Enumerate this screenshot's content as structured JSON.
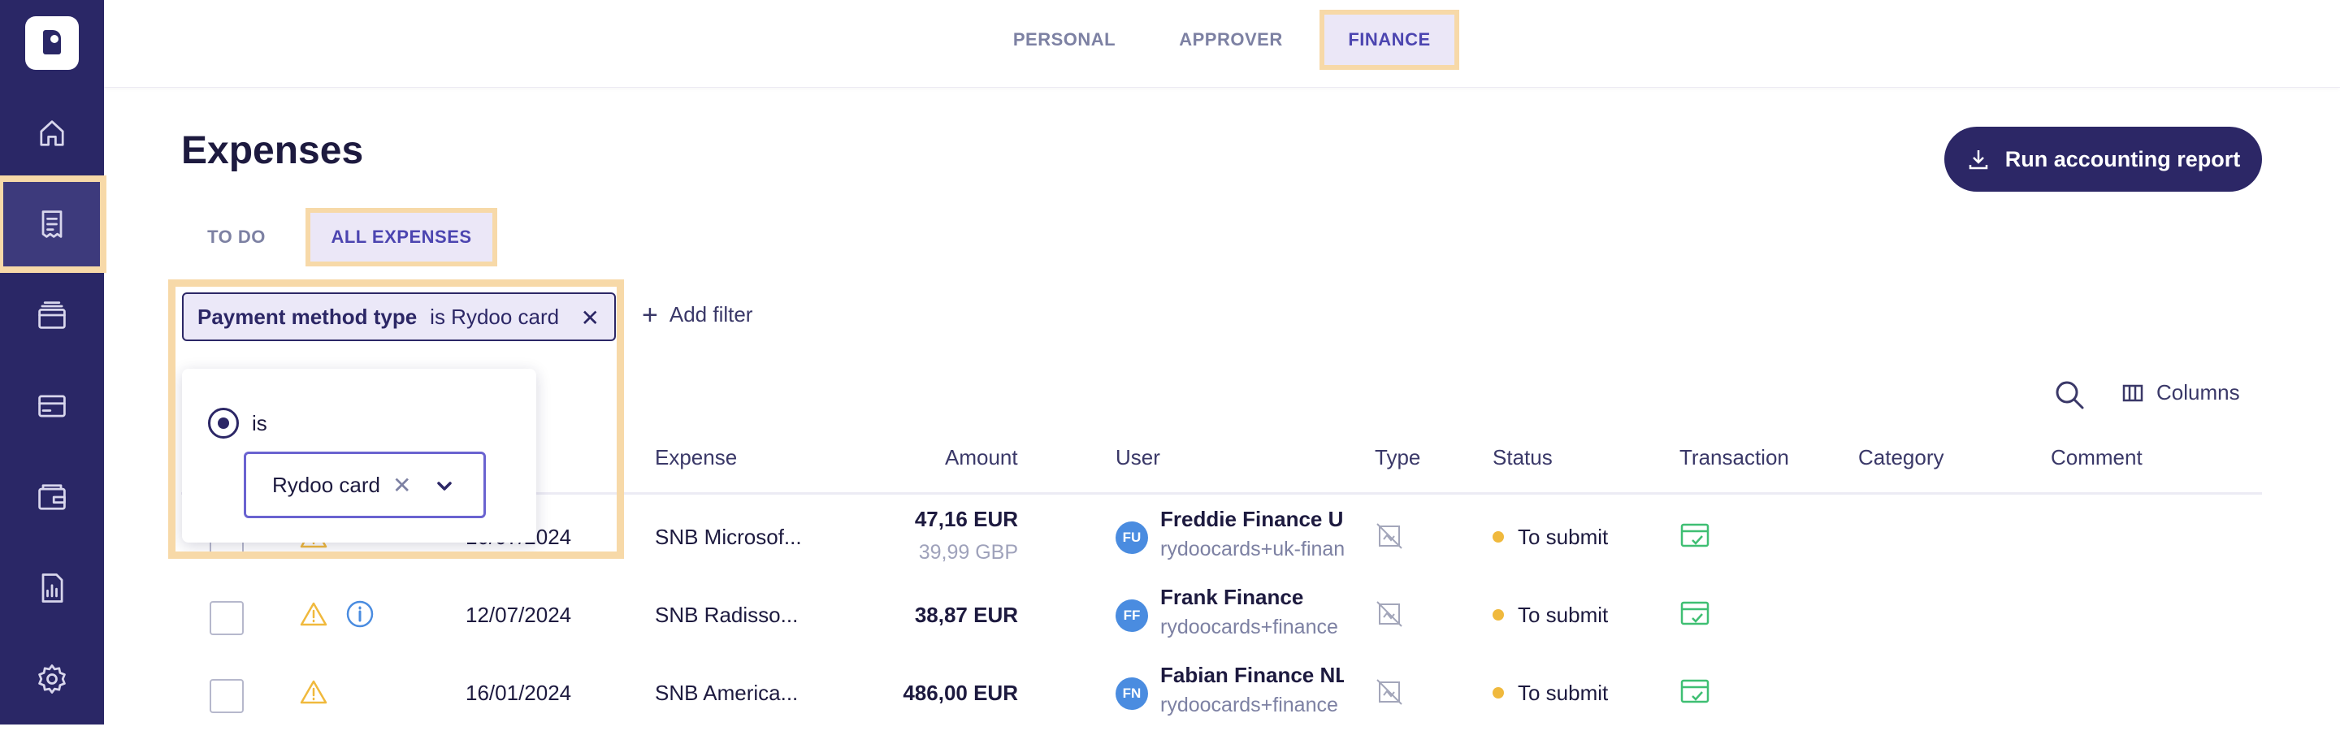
{
  "top_tabs": [
    {
      "label": "PERSONAL",
      "active": false
    },
    {
      "label": "APPROVER",
      "active": false
    },
    {
      "label": "FINANCE",
      "active": true
    }
  ],
  "page": {
    "title": "Expenses",
    "run_button_label": "Run accounting report"
  },
  "sub_tabs": [
    {
      "label": "TO DO",
      "active": false
    },
    {
      "label": "ALL EXPENSES",
      "active": true
    }
  ],
  "filter": {
    "field": "Payment method type",
    "value_text": "is Rydoo card",
    "close_glyph": "✕",
    "add_filter_label": "Add filter",
    "add_glyph": "+",
    "popover": {
      "radio_label": "is",
      "selected_value": "Rydoo card",
      "clear_glyph": "✕"
    }
  },
  "toolbar": {
    "columns_label": "Columns"
  },
  "table": {
    "headers": {
      "expense": "Expense",
      "amount": "Amount",
      "user": "User",
      "type": "Type",
      "status": "Status",
      "transaction": "Transaction",
      "category": "Category",
      "comment": "Comment"
    },
    "rows": [
      {
        "date": "10/07/2024",
        "expense": "SNB Microsof...",
        "amount": "47,16 EUR",
        "amount_original": "39,99 GBP",
        "user_initials": "FU",
        "user_name": "Freddie Finance UK",
        "user_email": "rydoocards+uk-finance",
        "status": "To submit",
        "has_warning": true,
        "has_info": false
      },
      {
        "date": "12/07/2024",
        "expense": "SNB Radisso...",
        "amount": "38,87 EUR",
        "amount_original": "",
        "user_initials": "FF",
        "user_name": "Frank Finance",
        "user_email": "rydoocards+finance",
        "status": "To submit",
        "has_warning": true,
        "has_info": true
      },
      {
        "date": "16/01/2024",
        "expense": "SNB America...",
        "amount": "486,00 EUR",
        "amount_original": "",
        "user_initials": "FN",
        "user_name": "Fabian Finance NL",
        "user_email": "rydoocards+finance",
        "status": "To submit",
        "has_warning": true,
        "has_info": false
      }
    ]
  },
  "colors": {
    "sidebar": "#2a2766",
    "accent": "#4c45b0",
    "highlight": "#f7d9a8",
    "warning": "#f0b93d",
    "transaction_ok": "#3fbf73"
  }
}
